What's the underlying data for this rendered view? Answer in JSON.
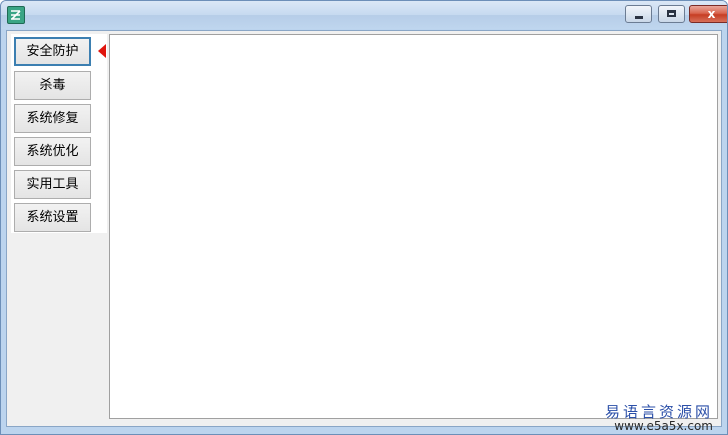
{
  "window": {
    "controls": {
      "close_label": "x"
    }
  },
  "sidebar": {
    "items": [
      {
        "label": "安全防护",
        "active": true
      },
      {
        "label": "杀毒"
      },
      {
        "label": "系统修复"
      },
      {
        "label": "系统优化"
      },
      {
        "label": "实用工具"
      },
      {
        "label": "系统设置"
      }
    ]
  },
  "watermark": {
    "title": "易语言资源网",
    "url": "www.e5a5x.com"
  },
  "colors": {
    "accent": "#3c7fb1",
    "indicator": "#e0150e",
    "watermark": "#2b4fa8"
  }
}
